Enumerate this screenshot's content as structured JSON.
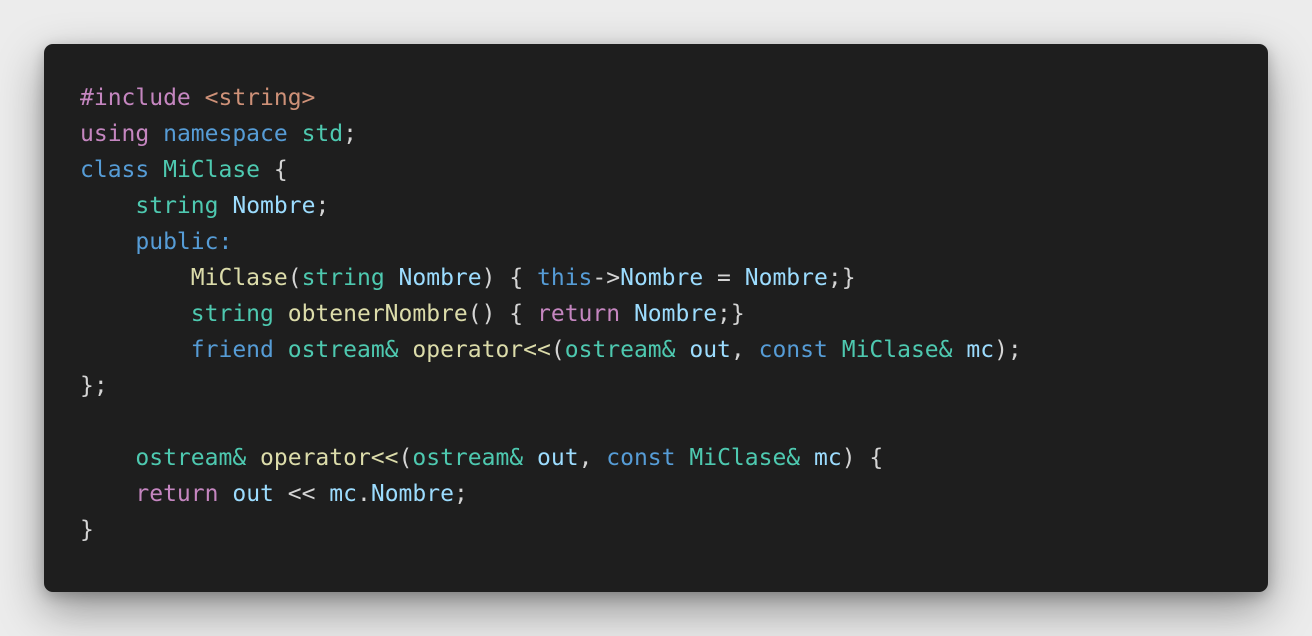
{
  "palette": {
    "background": "#1e1e1e",
    "page_background": "#ececec",
    "plain": "#d4d4d4",
    "control": "#c586c0",
    "keyword": "#569cd6",
    "type": "#4ec9b0",
    "variable": "#9cdcfe",
    "function": "#dcdcaa",
    "string": "#ce9178"
  },
  "code_lines": [
    {
      "tokens": [
        {
          "text": "#include ",
          "kind": "control"
        },
        {
          "text": "<string>",
          "kind": "string"
        }
      ]
    },
    {
      "tokens": [
        {
          "text": "using ",
          "kind": "control"
        },
        {
          "text": "namespace ",
          "kind": "keyword"
        },
        {
          "text": "std",
          "kind": "type"
        },
        {
          "text": ";",
          "kind": "plain"
        }
      ]
    },
    {
      "tokens": [
        {
          "text": "class ",
          "kind": "keyword"
        },
        {
          "text": "MiClase",
          "kind": "type"
        },
        {
          "text": " {",
          "kind": "plain"
        }
      ]
    },
    {
      "tokens": [
        {
          "text": "    ",
          "kind": "plain"
        },
        {
          "text": "string",
          "kind": "type"
        },
        {
          "text": " ",
          "kind": "plain"
        },
        {
          "text": "Nombre",
          "kind": "variable"
        },
        {
          "text": ";",
          "kind": "plain"
        }
      ]
    },
    {
      "tokens": [
        {
          "text": "    ",
          "kind": "plain"
        },
        {
          "text": "public:",
          "kind": "keyword"
        }
      ]
    },
    {
      "tokens": [
        {
          "text": "        ",
          "kind": "plain"
        },
        {
          "text": "MiClase",
          "kind": "function"
        },
        {
          "text": "(",
          "kind": "plain"
        },
        {
          "text": "string",
          "kind": "type"
        },
        {
          "text": " ",
          "kind": "plain"
        },
        {
          "text": "Nombre",
          "kind": "variable"
        },
        {
          "text": ") { ",
          "kind": "plain"
        },
        {
          "text": "this",
          "kind": "keyword"
        },
        {
          "text": "->",
          "kind": "plain"
        },
        {
          "text": "Nombre",
          "kind": "variable"
        },
        {
          "text": " = ",
          "kind": "plain"
        },
        {
          "text": "Nombre",
          "kind": "variable"
        },
        {
          "text": ";}",
          "kind": "plain"
        }
      ]
    },
    {
      "tokens": [
        {
          "text": "        ",
          "kind": "plain"
        },
        {
          "text": "string",
          "kind": "type"
        },
        {
          "text": " ",
          "kind": "plain"
        },
        {
          "text": "obtenerNombre",
          "kind": "function"
        },
        {
          "text": "() { ",
          "kind": "plain"
        },
        {
          "text": "return",
          "kind": "control"
        },
        {
          "text": " ",
          "kind": "plain"
        },
        {
          "text": "Nombre",
          "kind": "variable"
        },
        {
          "text": ";}",
          "kind": "plain"
        }
      ]
    },
    {
      "tokens": [
        {
          "text": "        ",
          "kind": "plain"
        },
        {
          "text": "friend",
          "kind": "keyword"
        },
        {
          "text": " ",
          "kind": "plain"
        },
        {
          "text": "ostream&",
          "kind": "type"
        },
        {
          "text": " ",
          "kind": "plain"
        },
        {
          "text": "operator<<",
          "kind": "function"
        },
        {
          "text": "(",
          "kind": "plain"
        },
        {
          "text": "ostream&",
          "kind": "type"
        },
        {
          "text": " ",
          "kind": "plain"
        },
        {
          "text": "out",
          "kind": "variable"
        },
        {
          "text": ", ",
          "kind": "plain"
        },
        {
          "text": "const",
          "kind": "keyword"
        },
        {
          "text": " ",
          "kind": "plain"
        },
        {
          "text": "MiClase&",
          "kind": "type"
        },
        {
          "text": " ",
          "kind": "plain"
        },
        {
          "text": "mc",
          "kind": "variable"
        },
        {
          "text": ");",
          "kind": "plain"
        }
      ]
    },
    {
      "tokens": [
        {
          "text": "};",
          "kind": "plain"
        }
      ]
    },
    {
      "tokens": []
    },
    {
      "tokens": [
        {
          "text": "    ",
          "kind": "plain"
        },
        {
          "text": "ostream&",
          "kind": "type"
        },
        {
          "text": " ",
          "kind": "plain"
        },
        {
          "text": "operator<<",
          "kind": "function"
        },
        {
          "text": "(",
          "kind": "plain"
        },
        {
          "text": "ostream&",
          "kind": "type"
        },
        {
          "text": " ",
          "kind": "plain"
        },
        {
          "text": "out",
          "kind": "variable"
        },
        {
          "text": ", ",
          "kind": "plain"
        },
        {
          "text": "const",
          "kind": "keyword"
        },
        {
          "text": " ",
          "kind": "plain"
        },
        {
          "text": "MiClase&",
          "kind": "type"
        },
        {
          "text": " ",
          "kind": "plain"
        },
        {
          "text": "mc",
          "kind": "variable"
        },
        {
          "text": ") {",
          "kind": "plain"
        }
      ]
    },
    {
      "tokens": [
        {
          "text": "    ",
          "kind": "plain"
        },
        {
          "text": "return",
          "kind": "control"
        },
        {
          "text": " ",
          "kind": "plain"
        },
        {
          "text": "out",
          "kind": "variable"
        },
        {
          "text": " << ",
          "kind": "plain"
        },
        {
          "text": "mc",
          "kind": "variable"
        },
        {
          "text": ".",
          "kind": "plain"
        },
        {
          "text": "Nombre",
          "kind": "variable"
        },
        {
          "text": ";",
          "kind": "plain"
        }
      ]
    },
    {
      "tokens": [
        {
          "text": "}",
          "kind": "plain"
        }
      ]
    }
  ]
}
